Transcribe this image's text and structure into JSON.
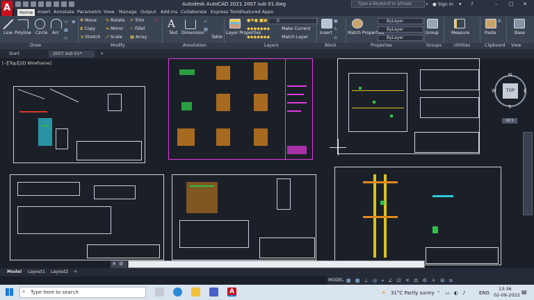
{
  "window": {
    "app_logo": "A",
    "title": "Autodesk AutoCAD 2021    2007 sub 01.dwg",
    "search_placeholder": "Type a keyword or phrase",
    "user": "Sign In"
  },
  "ribbon_tabs": [
    "Home",
    "Insert",
    "Annotate",
    "Parametric",
    "View",
    "Manage",
    "Output",
    "Add-ins",
    "Collaborate",
    "Express Tools",
    "Featured Apps"
  ],
  "draw_tools": {
    "line": "Line",
    "polyline": "Polyline",
    "circle": "Circle",
    "arc": "Arc"
  },
  "modify_tools": {
    "move": "Move",
    "rotate": "Rotate",
    "trim": "Trim",
    "copy": "Copy",
    "mirror": "Mirror",
    "fillet": "Fillet",
    "stretch": "Stretch",
    "scale": "Scale",
    "array": "Array"
  },
  "annotation_tools": {
    "text": "Text",
    "dimension": "Dimension",
    "table": "Table"
  },
  "layer_tools": {
    "layer_properties": "Layer Properties",
    "make_current": "Make Current",
    "match_layer": "Match Layer",
    "current_layer": "0"
  },
  "block_tools": {
    "insert": "Insert"
  },
  "properties_tools": {
    "match": "Match Properties",
    "bylayer1": "ByLayer",
    "bylayer2": "ByLayer",
    "bylayer3": "ByLayer"
  },
  "other_tools": {
    "group": "Group",
    "measure": "Measure",
    "paste": "Paste",
    "base": "Base"
  },
  "panel_labels": [
    "Draw",
    "Modify",
    "Annotation",
    "Layers",
    "Block",
    "Properties",
    "Groups",
    "Utilities",
    "Clipboard",
    "View"
  ],
  "doc_tabs": {
    "start": "Start",
    "file": "2007 sub 01*",
    "add": "+"
  },
  "viewport_label": "[–][Top][2D Wireframe]",
  "viewcube": {
    "n": "N",
    "s": "S",
    "e": "E",
    "w": "W",
    "face": "TOP",
    "wcs": "WCS"
  },
  "layout_tabs": [
    "Model",
    "Layout1",
    "Layout2",
    "+"
  ],
  "status": {
    "model": "MODEL"
  },
  "taskbar": {
    "search_placeholder": "Type here to search",
    "weather": "31°C  Partly sunny",
    "lang": "ENG",
    "time": "13:36",
    "date": "02-09-2022"
  }
}
